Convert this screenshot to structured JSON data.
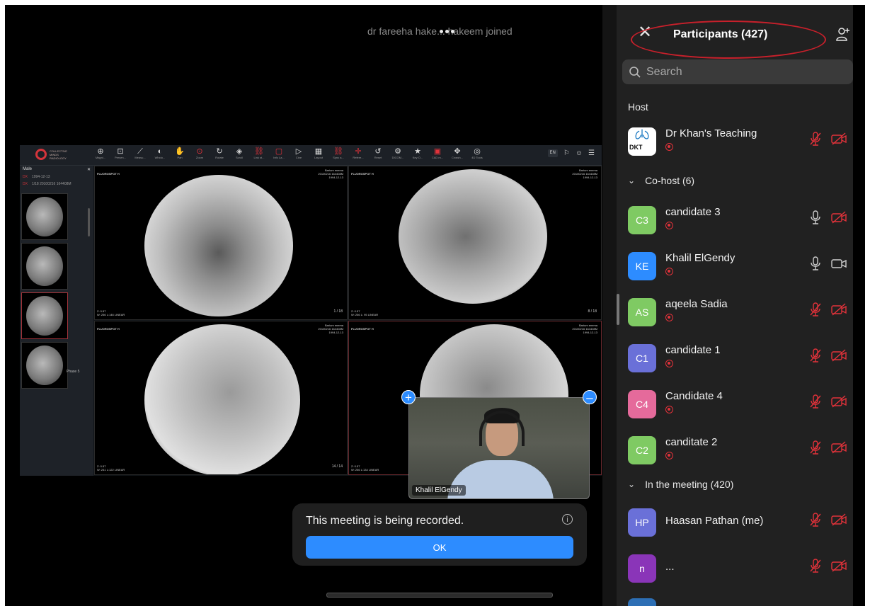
{
  "notification": {
    "text": "dr fareeha hake... hakeem joined"
  },
  "viewer": {
    "brand": [
      "COLLECTIVE",
      "MINDS",
      "RADIOLOGY"
    ],
    "tools": [
      {
        "label": "Magni...",
        "icon": "magnifier-icon",
        "glyph": "⊕",
        "red": false
      },
      {
        "label": "Presen...",
        "icon": "presentation-icon",
        "glyph": "⊡",
        "red": false
      },
      {
        "label": "Measu...",
        "icon": "measure-icon",
        "glyph": "⟋",
        "red": false
      },
      {
        "label": "Windo...",
        "icon": "window-level-icon",
        "glyph": "◐",
        "red": false
      },
      {
        "label": "Pan",
        "icon": "pan-icon",
        "glyph": "✋",
        "red": false
      },
      {
        "label": "Zoom",
        "icon": "zoom-icon",
        "glyph": "⊙",
        "red": true
      },
      {
        "label": "Rotate",
        "icon": "rotate-icon",
        "glyph": "↻",
        "red": false
      },
      {
        "label": "Scroll",
        "icon": "scroll-icon",
        "glyph": "◈",
        "red": false
      },
      {
        "label": "Link st...",
        "icon": "link-icon",
        "glyph": "⛓",
        "red": true
      },
      {
        "label": "Info La...",
        "icon": "info-layer-icon",
        "glyph": "▢",
        "red": true
      },
      {
        "label": "Cine",
        "icon": "cine-icon",
        "glyph": "▷",
        "red": false
      },
      {
        "label": "Layout",
        "icon": "layout-icon",
        "glyph": "▦",
        "red": false
      },
      {
        "label": "Sync a...",
        "icon": "sync-icon",
        "glyph": "⛓",
        "red": true
      },
      {
        "label": "Refere...",
        "icon": "reference-icon",
        "glyph": "✛",
        "red": true
      },
      {
        "label": "Reset",
        "icon": "reset-icon",
        "glyph": "↺",
        "red": false
      },
      {
        "label": "DICOM...",
        "icon": "dicom-icon",
        "glyph": "⚙",
        "red": false
      },
      {
        "label": "Key O...",
        "icon": "star-icon",
        "glyph": "★",
        "red": false
      },
      {
        "label": "CAD m...",
        "icon": "cad-icon",
        "glyph": "▣",
        "red": true
      },
      {
        "label": "Crossh...",
        "icon": "crosshair-icon",
        "glyph": "✥",
        "red": false
      },
      {
        "label": "4D Tools",
        "icon": "4d-tools-icon",
        "glyph": "◎",
        "red": false
      }
    ],
    "lang": "EN",
    "sidebar": {
      "sex": "Male",
      "dob": "1994-12-13",
      "study": "1/18 20100216 164408M",
      "phase": "Phase 5",
      "badges": [
        "DX",
        "DX"
      ]
    },
    "panes": [
      {
        "label": "FLUOROSPOT H",
        "desc": "Barium enema",
        "date": "20100216 164408M",
        "dob": "1994-12-13",
        "z": "Z: 0.57",
        "wl": "W: 256 L:146 LINEAR",
        "count": "1 / 18"
      },
      {
        "label": "FLUOROSPOT H",
        "desc": "Barium enema",
        "date": "20100216 164408M",
        "dob": "1994-12-13",
        "z": "Z: 0.57",
        "wl": "W: 256 L: 95 LINEAR",
        "count": "8 / 18"
      },
      {
        "label": "FLUOROSPOT H",
        "desc": "Barium enema",
        "date": "20100216 164408M",
        "dob": "1994-12-13",
        "z": "Z: 0.57",
        "wl": "W: 241 L:122 LINEAR",
        "count": "14 / 14"
      },
      {
        "label": "FLUOROSPOT H",
        "desc": "Barium enema",
        "date": "20100216 164408M",
        "dob": "1994-12-13",
        "z": "Z: 0.57",
        "wl": "W: 256 L:134 LINEAR",
        "count": ""
      }
    ]
  },
  "video": {
    "name": "Khalil ElGendy"
  },
  "recording": {
    "message": "This meeting is being recorded.",
    "ok_label": "OK"
  },
  "panel": {
    "title": "Participants (427)",
    "search_placeholder": "Search",
    "host_label": "Host",
    "host": {
      "name": "Dr Khan's Teaching",
      "avatar": "DKT",
      "mic": "muted",
      "video": "off"
    },
    "cohost_label": "Co-host (6)",
    "cohosts": [
      {
        "name": "candidate 3",
        "initials": "C3",
        "color": "#7fca63",
        "mic": "on",
        "video": "off"
      },
      {
        "name": "Khalil ElGendy",
        "initials": "KE",
        "color": "#2d8cff",
        "mic": "on",
        "video": "on"
      },
      {
        "name": "aqeela Sadia",
        "initials": "AS",
        "color": "#7fca63",
        "mic": "muted",
        "video": "off"
      },
      {
        "name": "candidate 1",
        "initials": "C1",
        "color": "#6a70d8",
        "mic": "muted",
        "video": "off"
      },
      {
        "name": "Candidate 4",
        "initials": "C4",
        "color": "#e56a9b",
        "mic": "muted",
        "video": "off"
      },
      {
        "name": "canditate 2",
        "initials": "C2",
        "color": "#7fca63",
        "mic": "muted",
        "video": "off"
      }
    ],
    "meeting_label": "In the meeting (420)",
    "attendees": [
      {
        "name": "Haasan Pathan (me)",
        "initials": "HP",
        "color": "#6a70d8",
        "mic": "muted",
        "video": "off"
      },
      {
        "name": "...",
        "initials": "n",
        "color": "#8a35b8",
        "mic": "muted",
        "video": "off"
      }
    ]
  }
}
